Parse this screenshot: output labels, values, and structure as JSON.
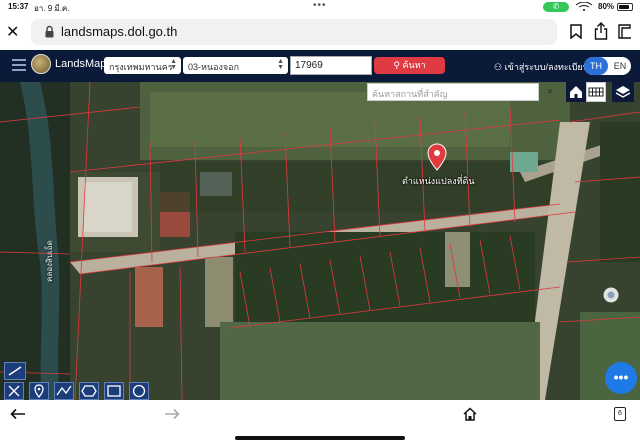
{
  "status_bar": {
    "time": "15:37",
    "date": "อา. 9 มี.ค.",
    "call_icon": "phone-icon",
    "battery_percent": "80%",
    "battery_level": 0.8
  },
  "browser": {
    "url": "landsmaps.dol.go.th",
    "close_icon": "close-icon",
    "lock_icon": "lock-icon",
    "bookmark_icon": "bookmark-icon",
    "share_icon": "share-icon",
    "tabs_icon": "tabs-icon",
    "tab_count": "6"
  },
  "toolbar": {
    "app_name": "LandsMaps",
    "province": "กรุงเทพมหานคร",
    "district": "03-หนองจอก",
    "parcel_number": "17969",
    "search_label": "ค้นหา",
    "login_label": "เข้าสู่ระบบ/ลงทะเบียน",
    "lang_th": "TH",
    "lang_en": "EN"
  },
  "map": {
    "place_search_placeholder": "ค้นหาสถานที่สำคัญ",
    "clear_label": "×",
    "marker_label": "ตำแหน่งแปลงที่ดิน",
    "road_label": "คลองสิบเอ็ด",
    "fab_label": "•••",
    "accent_color": "#e03b42",
    "toolbar_color": "#0c1a3a"
  }
}
